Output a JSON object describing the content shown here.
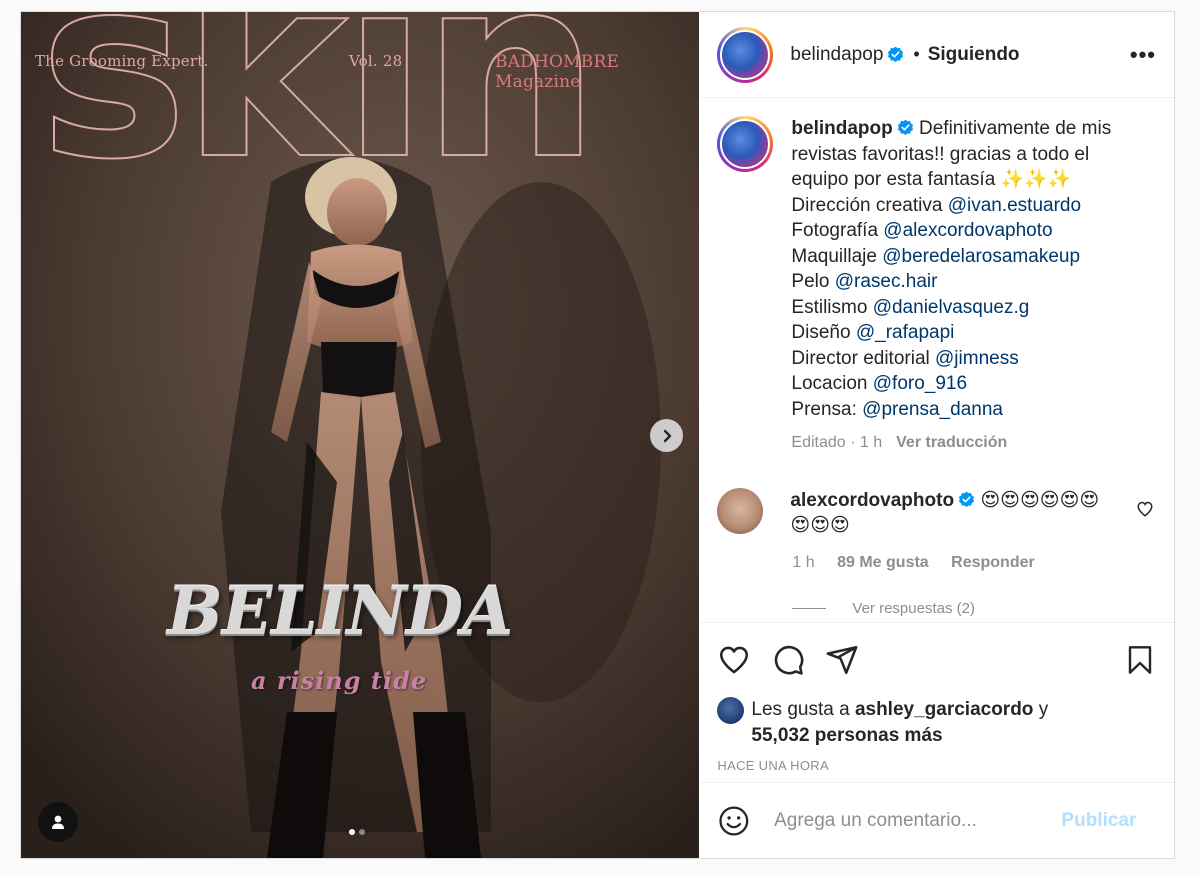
{
  "media": {
    "cover_top_left": "The Grooming Expert.",
    "cover_top_mid": "Vol. 28",
    "cover_top_right": "BADHOMBRE Magazine",
    "cover_title": "skin",
    "cover_name": "BELINDA",
    "cover_subtitle": "a rising tide",
    "slide_count": 2,
    "active_slide": 1
  },
  "header": {
    "username": "belindapop",
    "separator": "•",
    "follow_status": "Siguiendo",
    "more": "•••"
  },
  "caption": {
    "username": "belindapop",
    "intro": "Definitivamente de mis revistas favoritas!! gracias a todo el equipo por esta fantasía ✨✨✨",
    "credits": [
      {
        "role": "Dirección creativa",
        "handle": "@ivan.estuardo"
      },
      {
        "role": "Fotografía",
        "handle": "@alexcordovaphoto"
      },
      {
        "role": "Maquillaje",
        "handle": "@beredelarosamakeup"
      },
      {
        "role": "Pelo",
        "handle": "@rasec.hair"
      },
      {
        "role": "Estilismo",
        "handle": "@danielvasquez.g"
      },
      {
        "role": "Diseño",
        "handle": "@_rafapapi"
      },
      {
        "role": "Director editorial",
        "handle": "@jimness"
      },
      {
        "role": "Locacion",
        "handle": "@foro_916"
      },
      {
        "role": "Prensa:",
        "handle": "@prensa_danna"
      }
    ],
    "edited": "Editado · 1 h",
    "translate": "Ver traducción"
  },
  "comment": {
    "username": "alexcordovaphoto",
    "text": "😍😍😍😍😍😍😍😍😍",
    "time": "1 h",
    "likes": "89 Me gusta",
    "reply": "Responder",
    "view_replies": "Ver respuestas (2)"
  },
  "likes": {
    "prefix": "Les gusta a",
    "user": "ashley_garciacordo",
    "and": "y",
    "count": "55,032 personas más"
  },
  "timestamp": "HACE UNA HORA",
  "compose": {
    "placeholder": "Agrega un comentario...",
    "publish": "Publicar"
  },
  "colors": {
    "link": "#00376b",
    "verified": "#0095f6",
    "publish_disabled": "#b2dffc"
  }
}
